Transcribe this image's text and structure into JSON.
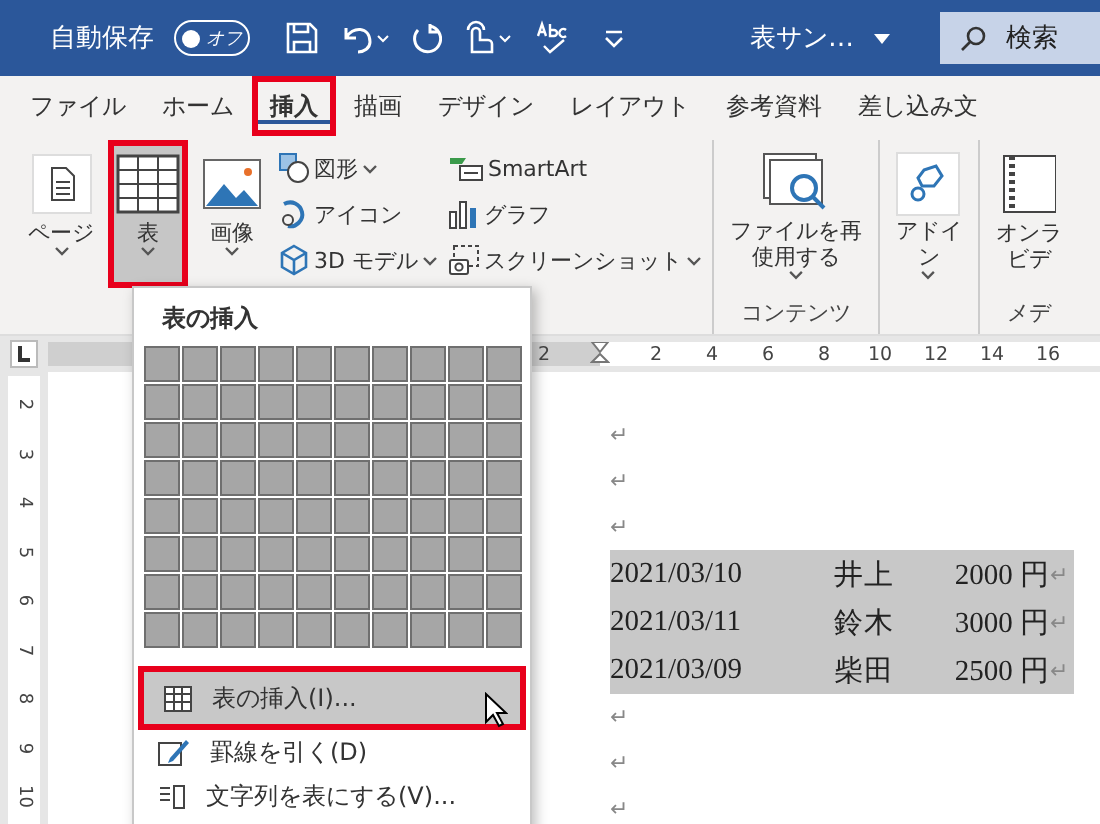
{
  "title_bar": {
    "autosave_label": "自動保存",
    "autosave_toggle": {
      "label": "オフ",
      "on": false
    },
    "document_title": "表サン…",
    "search": {
      "placeholder": "検索"
    }
  },
  "tabs": [
    {
      "label": "ファイル",
      "selected": false,
      "highlighted": false
    },
    {
      "label": "ホーム",
      "selected": false,
      "highlighted": false
    },
    {
      "label": "挿入",
      "selected": true,
      "highlighted": true
    },
    {
      "label": "描画",
      "selected": false,
      "highlighted": false
    },
    {
      "label": "デザイン",
      "selected": false,
      "highlighted": false
    },
    {
      "label": "レイアウト",
      "selected": false,
      "highlighted": false
    },
    {
      "label": "参考資料",
      "selected": false,
      "highlighted": false
    },
    {
      "label": "差し込み文",
      "selected": false,
      "highlighted": false
    }
  ],
  "ribbon": {
    "groups": [
      {
        "items": [
          {
            "kind": "large",
            "lines": [
              "ページ"
            ],
            "dropdown": true,
            "pressed": false,
            "highlighted": false
          },
          {
            "kind": "large",
            "lines": [
              "表"
            ],
            "dropdown": true,
            "pressed": true,
            "highlighted": true
          },
          {
            "kind": "large",
            "lines": [
              "画像"
            ],
            "dropdown": true,
            "pressed": false,
            "highlighted": false
          },
          {
            "kind": "stack",
            "entries": [
              {
                "label": "図形",
                "dropdown": true
              },
              {
                "label": "アイコン",
                "dropdown": false
              },
              {
                "label": "3D モデル",
                "dropdown": true
              }
            ]
          },
          {
            "kind": "stack",
            "entries": [
              {
                "label": "SmartArt",
                "dropdown": false
              },
              {
                "label": "グラフ",
                "dropdown": false
              },
              {
                "label": "スクリーンショット",
                "dropdown": true
              }
            ]
          }
        ]
      },
      {
        "label": "コンテンツ",
        "items": [
          {
            "kind": "large",
            "lines": [
              "ファイルを再",
              "使用する"
            ],
            "dropdown": true,
            "pressed": false,
            "highlighted": false
          }
        ]
      },
      {
        "items": [
          {
            "kind": "large",
            "lines": [
              "アドイ",
              "ン"
            ],
            "dropdown": true,
            "pressed": false,
            "highlighted": false
          }
        ]
      },
      {
        "label": "メデ",
        "items": [
          {
            "kind": "large",
            "lines": [
              "オンラ",
              "ビデ"
            ],
            "dropdown": false,
            "pressed": false,
            "highlighted": false
          }
        ]
      }
    ]
  },
  "ruler": {
    "numbers": [
      "2",
      "2",
      "4",
      "6",
      "8",
      "10",
      "12",
      "14",
      "16"
    ]
  },
  "vertical_ruler": {
    "numbers": [
      "2",
      "3",
      "4",
      "5",
      "6",
      "7",
      "8",
      "9",
      "10"
    ]
  },
  "document": {
    "paragraphs": [
      {
        "kind": "empty",
        "mark": "↵"
      },
      {
        "kind": "empty",
        "mark": "↵"
      },
      {
        "kind": "empty",
        "mark": "↵"
      },
      {
        "kind": "row",
        "selected": true,
        "cells": [
          "2021/03/10",
          "井上",
          "2000 円"
        ],
        "mark": "↵"
      },
      {
        "kind": "row",
        "selected": true,
        "cells": [
          "2021/03/11",
          "鈴木",
          "3000 円"
        ],
        "mark": "↵"
      },
      {
        "kind": "row",
        "selected": true,
        "cells": [
          "2021/03/09",
          "柴田",
          "2500 円"
        ],
        "mark": "↵"
      },
      {
        "kind": "empty",
        "mark": "↵"
      },
      {
        "kind": "empty",
        "mark": "↵"
      },
      {
        "kind": "empty",
        "mark": "↵"
      }
    ]
  },
  "table_menu": {
    "title": "表の挿入",
    "items": [
      {
        "label": "表の挿入(I)...",
        "selected": true,
        "highlighted": true
      },
      {
        "label": "罫線を引く(D)",
        "selected": false,
        "highlighted": false
      },
      {
        "label": "文字列を表にする(V)...",
        "selected": false,
        "highlighted": false
      }
    ]
  }
}
